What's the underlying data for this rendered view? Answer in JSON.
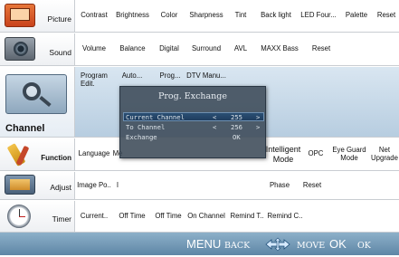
{
  "menu": {
    "rows": [
      {
        "category": "Picture",
        "icon": "picture-icon",
        "items": [
          "Contrast",
          "Brightness",
          "Color",
          "Sharpness",
          "Tint",
          "Back light",
          "LED Four...",
          "Palette",
          "Reset"
        ]
      },
      {
        "category": "Sound",
        "icon": "sound-icon",
        "items": [
          "Volume",
          "Balance",
          "Digital",
          "Surround",
          "AVL",
          "MAXX Bass",
          "Reset"
        ]
      },
      {
        "category": "Channel",
        "icon": "channel-icon",
        "items": [
          "Program Edit.",
          "Auto...",
          "Prog...",
          "DTV Manu..."
        ]
      },
      {
        "category": "Function",
        "icon": "function-icon",
        "items": [
          "Language",
          "Me",
          "Intelligent Mode",
          "OPC",
          "Eye Guard Mode",
          "Net Upgrade"
        ]
      },
      {
        "category": "Adjust",
        "icon": "adjust-icon",
        "items": [
          "Image Po..",
          "I",
          "Phase",
          "Reset"
        ]
      },
      {
        "category": "Timer",
        "icon": "timer-icon",
        "items": [
          "Current..",
          "Off Time",
          "Off Time",
          "On Channel",
          "Remind T..",
          "Remind C.."
        ]
      }
    ]
  },
  "dialog": {
    "title": "Prog. Exchange",
    "rows": [
      {
        "label": "Current Channel",
        "left": "<",
        "value": "255",
        "right": ">",
        "selected": true
      },
      {
        "label": "To Channel",
        "left": "<",
        "value": "256",
        "right": ">",
        "selected": false
      },
      {
        "label": "Exchange",
        "left": "",
        "value": "OK",
        "right": "",
        "selected": false
      }
    ]
  },
  "bottom": {
    "menu_key": "MENU",
    "menu_action": "BACK",
    "move_icon": "arrows-cross-icon",
    "move_action": "MOVE",
    "ok_key": "OK",
    "ok_action": "OK"
  },
  "colors": {
    "bottom_bar": "#7399b8",
    "dialog": "#3c4a58",
    "selected_row": "#2b4f74",
    "channel_row": "#a9c4dc"
  }
}
